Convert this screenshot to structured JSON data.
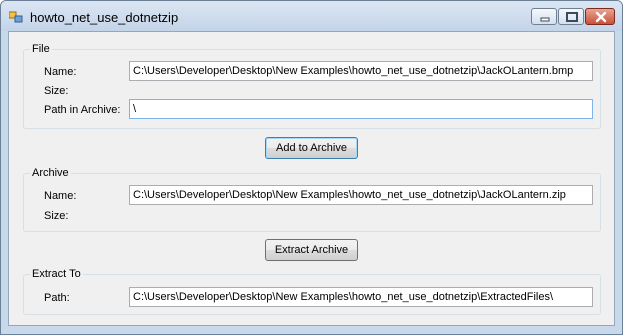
{
  "window": {
    "title": "howto_net_use_dotnetzip",
    "icons": {
      "app": "app-icon",
      "minimize": "minimize-icon",
      "maximize": "maximize-icon",
      "close": "close-icon"
    }
  },
  "file_group": {
    "title": "File",
    "name_label": "Name:",
    "name_value": "C:\\Users\\Developer\\Desktop\\New Examples\\howto_net_use_dotnetzip\\JackOLantern.bmp",
    "size_label": "Size:",
    "path_label": "Path in Archive:",
    "path_value": "\\"
  },
  "add_button": "Add to Archive",
  "archive_group": {
    "title": "Archive",
    "name_label": "Name:",
    "name_value": "C:\\Users\\Developer\\Desktop\\New Examples\\howto_net_use_dotnetzip\\JackOLantern.zip",
    "size_label": "Size:"
  },
  "extract_button": "Extract Archive",
  "extract_group": {
    "title": "Extract To",
    "path_label": "Path:",
    "path_value": "C:\\Users\\Developer\\Desktop\\New Examples\\howto_net_use_dotnetzip\\ExtractedFiles\\"
  }
}
